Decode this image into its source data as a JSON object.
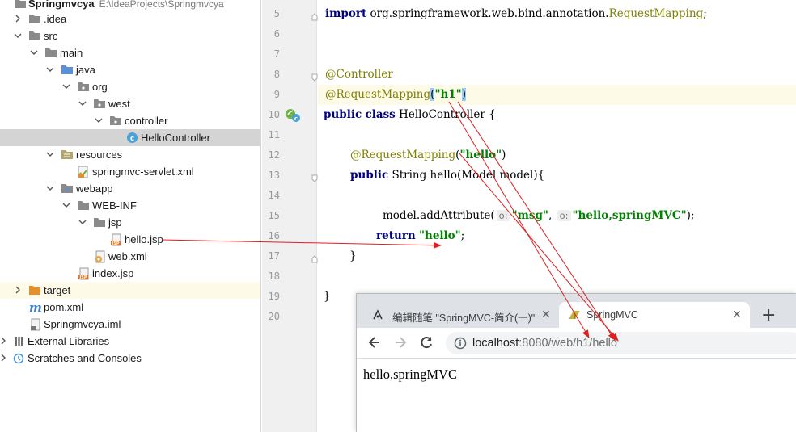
{
  "project": {
    "name": "Springmvcya",
    "path": "E:\\IdeaProjects\\Springmvcya"
  },
  "tree": {
    "idea": ".idea",
    "src": "src",
    "main": "main",
    "java": "java",
    "org": "org",
    "west": "west",
    "controller": "controller",
    "hello_controller": "HelloController",
    "resources": "resources",
    "servlet_xml": "springmvc-servlet.xml",
    "webapp": "webapp",
    "web_inf": "WEB-INF",
    "jsp": "jsp",
    "hello_jsp": "hello.jsp",
    "web_xml": "web.xml",
    "index_jsp": "index.jsp",
    "target": "target",
    "pom": "pom.xml",
    "iml": "Springmvcya.iml",
    "external_libraries": "External Libraries",
    "scratches": "Scratches and Consoles"
  },
  "editor": {
    "line_numbers": [
      "5",
      "6",
      "7",
      "8",
      "9",
      "10",
      "11",
      "12",
      "13",
      "14",
      "15",
      "16",
      "17",
      "18",
      "19",
      "20"
    ],
    "l5_import": "import",
    "l5_pkg": " org.springframework.web.bind.annotation.",
    "l5_class": "RequestMapping",
    "l5_semi": ";",
    "l8_controller": "@Controller",
    "l9_mapping": "@RequestMapping",
    "l9_open": "(",
    "l9_value": "\"h1\"",
    "l9_close": ")",
    "l10_public": "public",
    "l10_class": "class",
    "l10_name": " HelloController {",
    "l12_mapping": "@RequestMapping",
    "l12_open": "(",
    "l12_value": "\"hello\"",
    "l12_close": ")",
    "l13_public": "public",
    "l13_rest": " String hello(Model model){",
    "l15_call": "model.addAttribute(",
    "l15_hint1": "o:",
    "l15_msg": "\"msg\"",
    "l15_comma": ", ",
    "l15_hint2": "o:",
    "l15_val": "\"hello,springMVC\"",
    "l15_end": ");",
    "l16_return": "return",
    "l16_val": "\"hello\"",
    "l16_semi": ";",
    "l17_brace": "}",
    "l19_brace": "}"
  },
  "browser": {
    "tab1_title": "编辑随笔 \"SpringMVC-简介(一)\"",
    "tab2_title": "SpringMVC",
    "close_glyph": "✕",
    "new_tab_glyph": "+",
    "url_host": "localhost",
    "url_path": ":8080/web/h1/hello",
    "page_text": "hello,springMVC"
  },
  "colors": {
    "keyword": "#000080",
    "annotation": "#808000",
    "string": "#008000",
    "arrow": "#e02020"
  }
}
